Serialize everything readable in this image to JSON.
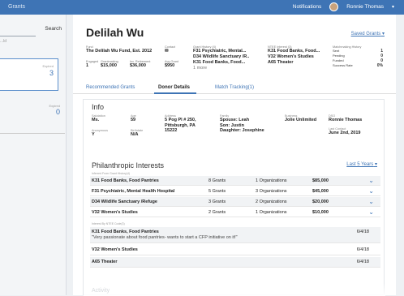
{
  "topbar": {
    "nav_item": "Grants",
    "notifications": "Notifications",
    "user_name": "Ronnie Thomas"
  },
  "left": {
    "search_label": "Search",
    "search_placeholder": "...ld",
    "card1_label": "Expired",
    "card1_count": "3",
    "card2_label": "Expired",
    "card2_count": "0"
  },
  "profile": {
    "name": "Delilah Wu",
    "saved_grants": "Saved Grants",
    "fund_label": "Fund",
    "fund_value": "The Delilah Wu Fund, Est. 2012",
    "contact_label": "Contact",
    "grant_history_label": "Grant History (4)",
    "grant_history": [
      "F31 Psychiatric, Mental...",
      "D34 Wildlife Sanctuary /R..",
      "K31 Food Banks, Food...",
      "1 more"
    ],
    "ntee_label": "NTEE Interest (3)",
    "ntee": [
      "K31 Food Banks, Food...",
      "V32 Women's Studies",
      "A65 Theater"
    ],
    "engaged_label": "Engaged",
    "engaged_value": "1",
    "grantmaking_label": "Grantmaking",
    "grantmaking_value": "$15,000",
    "inv_label": "Inv. Retirement",
    "inv_value": "$36,000",
    "avg_label": "Avg Grant",
    "avg_value": "$950",
    "matchmaking_label": "Matchmaking History",
    "matchmaking": [
      {
        "label": "Sent",
        "value": "1"
      },
      {
        "label": "Pending",
        "value": "0"
      },
      {
        "label": "Funded",
        "value": "0"
      },
      {
        "label": "Success Rate",
        "value": "0%"
      }
    ]
  },
  "tabs": {
    "recommended": "Recommended Grants",
    "donor": "Donor Details",
    "match": "Match Tracking(1)"
  },
  "info": {
    "title": "Info",
    "salutation_label": "Salutation",
    "salutation": "Ms.",
    "age_label": "Age",
    "age": "59",
    "address_label": "Address",
    "address1": "5 Pog Pl # 250,",
    "address2": "Pittsburgh, PA",
    "address3": "15222",
    "family_label": "Family",
    "family1": "Spouse: Leah",
    "family2": "Son: Justin",
    "family3": "Daughter: Josephine",
    "business_label": "Business",
    "business": "Jolie Unlimited",
    "dso_label": "DSO",
    "dso": "Ronnie Thomas",
    "anonymous_label": "Anonymous",
    "anonymous": "Y",
    "birthdate_label": "Birthdate",
    "birthdate": "N/A",
    "last_contact_label": "Last Contact",
    "last_contact": "June 2nd, 2019"
  },
  "phil": {
    "title": "Philanthropic Interests",
    "last5": "Last 5 Years",
    "sub1": "Inferred From Grant History(4)",
    "rows": [
      {
        "name": "K31 Food Banks, Food Pantries",
        "grants": "8 Grants",
        "orgs": "1 Organizations",
        "amount": "$85,000"
      },
      {
        "name": "F31 Psychiatric, Mental Health Hospital",
        "grants": "5 Grants",
        "orgs": "3 Organizations",
        "amount": "$45,000"
      },
      {
        "name": "D34 Wildlife Sanctuary /Refuge",
        "grants": "3 Grants",
        "orgs": "2 Organizations",
        "amount": "$20,000"
      },
      {
        "name": "V32 Women's Studies",
        "grants": "2 Grants",
        "orgs": "1 Organizations",
        "amount": "$10,000"
      }
    ],
    "sub2": "Interest By NTEE Code(3)",
    "ntee_rows": [
      {
        "name": "K31 Food Banks, Food Pantries",
        "quote": "\"Very passionate about food pantries- wants to start a CFP initiative on it!\"",
        "date": "6/4/18"
      },
      {
        "name": "V32 Women's Studies",
        "date": "6/4/18"
      },
      {
        "name": "A65 Theater",
        "date": "6/4/18"
      }
    ],
    "ghost": "Activity"
  }
}
